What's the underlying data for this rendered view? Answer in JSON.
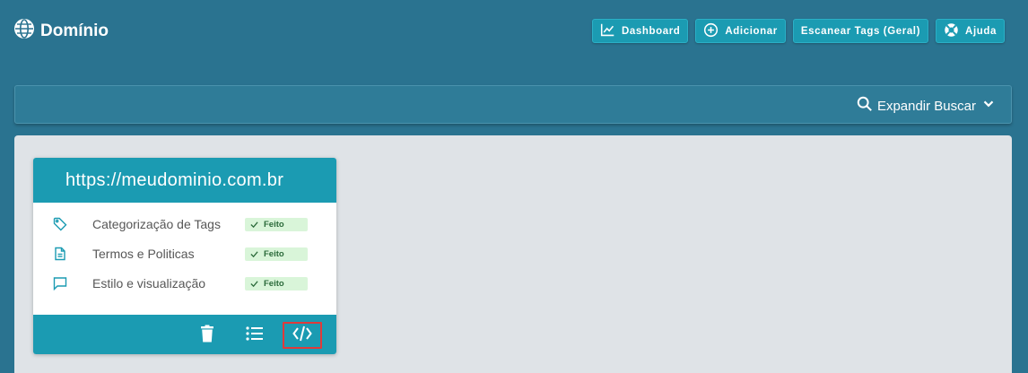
{
  "header": {
    "title": "Domínio",
    "buttons": {
      "dashboard": "Dashboard",
      "add": "Adicionar",
      "scan": "Escanear Tags (Geral)",
      "help": "Ajuda"
    }
  },
  "search": {
    "expand_label": "Expandir Buscar"
  },
  "card": {
    "url": "https://meudominio.com.br",
    "items": [
      {
        "label": "Categorização de Tags",
        "status": "Feito",
        "icon": "tag-icon"
      },
      {
        "label": "Termos e Politicas",
        "status": "Feito",
        "icon": "document-icon"
      },
      {
        "label": "Estilo e visualização",
        "status": "Feito",
        "icon": "chat-icon"
      }
    ],
    "actions": [
      "trash-icon",
      "list-icon",
      "code-icon"
    ]
  },
  "colors": {
    "background": "#2a7390",
    "accent": "#1b9bb2",
    "panel": "#dfe3e7",
    "success_bg": "#d9f5d9",
    "highlight": "#e03a3a"
  }
}
